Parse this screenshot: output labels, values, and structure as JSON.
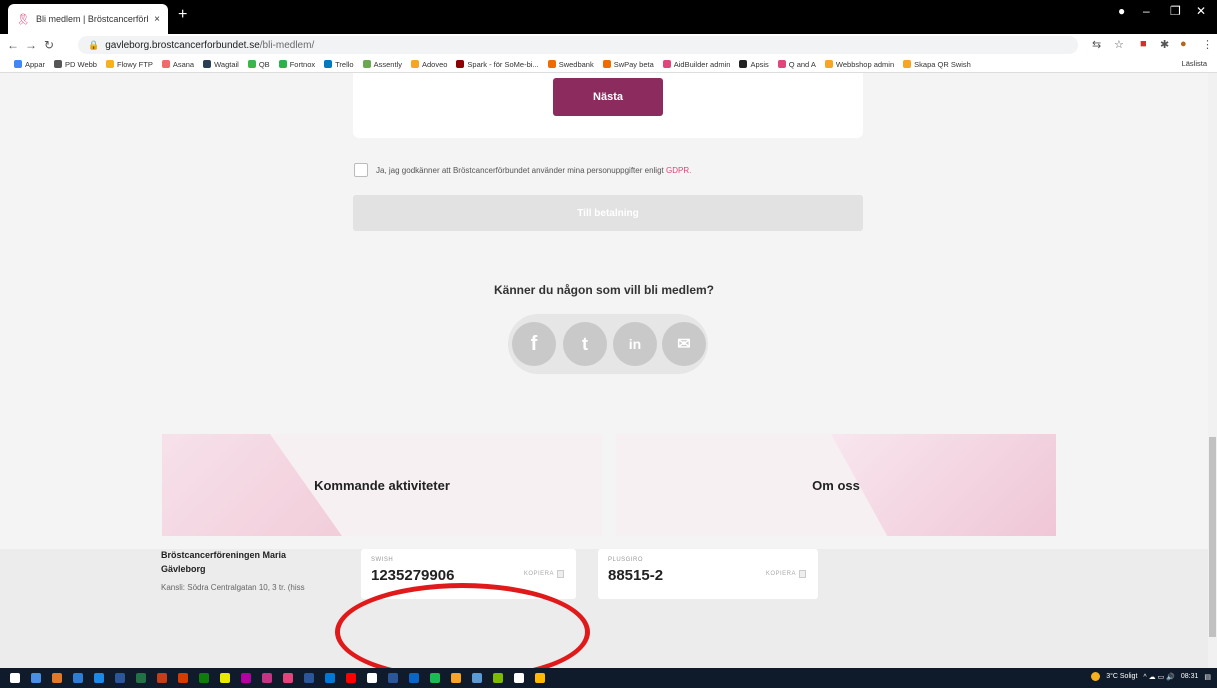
{
  "browser": {
    "tab_title": "Bli medlem | Bröstcancerförbund",
    "tab_close": "×",
    "new_tab": "+",
    "url_host": "gavleborg.brostcancerforbundet.se",
    "url_path": "/bli-medlem/",
    "bookmarks": [
      "Appar",
      "PD Webb",
      "Flowy FTP",
      "Asana",
      "Wagtail",
      "QB",
      "Fortnox",
      "Trello",
      "Assently",
      "Adoveo",
      "Spark - för SoMe-bi...",
      "Swedbank",
      "SwPay beta",
      "AidBuilder admin",
      "Apsis",
      "Q and A",
      "Webbshop admin",
      "Skapa QR Swish"
    ],
    "bookmark_colors": [
      "#4285f4",
      "#555555",
      "#f6b11d",
      "#f06a6a",
      "#2a3f54",
      "#39b54a",
      "#2bb24c",
      "#0079bf",
      "#6aa84f",
      "#f6a623",
      "#8b0000",
      "#ef6c00",
      "#ef6c00",
      "#e0457b",
      "#222222",
      "#e0457b",
      "#f6a623",
      "#f6a623"
    ],
    "reading_list": "Läslista"
  },
  "form": {
    "next_label": "Nästa",
    "consent_text": "Ja, jag godkänner att Bröstcancerförbundet använder mina personuppgifter enligt",
    "gdpr_link": "GDPR.",
    "pay_label": "Till betalning"
  },
  "share": {
    "heading": "Känner du någon som vill bli medlem?",
    "icons": [
      {
        "name": "facebook-icon",
        "glyph": "f"
      },
      {
        "name": "twitter-icon",
        "glyph": "t"
      },
      {
        "name": "linkedin-icon",
        "glyph": "in"
      },
      {
        "name": "email-icon",
        "glyph": "✉"
      }
    ]
  },
  "promos": {
    "left": "Kommande aktiviteter",
    "right": "Om oss"
  },
  "footer": {
    "org_name": "Bröstcancerföreningen Maria Gävleborg",
    "address": "Kansli: Södra Centralgatan 10, 3 tr. (hiss",
    "swish": {
      "label": "SWISH",
      "value": "1235279906",
      "copy": "KOPIERA"
    },
    "plusgiro": {
      "label": "PLUSGIRO",
      "value": "88515-2",
      "copy": "KOPIERA"
    }
  },
  "taskbar": {
    "weather": "3°C Soligt",
    "time": "08:31"
  },
  "colors": {
    "brand": "#8c2c5e",
    "accent_pink": "#e0457b",
    "highlight_red": "#e01a1a"
  }
}
